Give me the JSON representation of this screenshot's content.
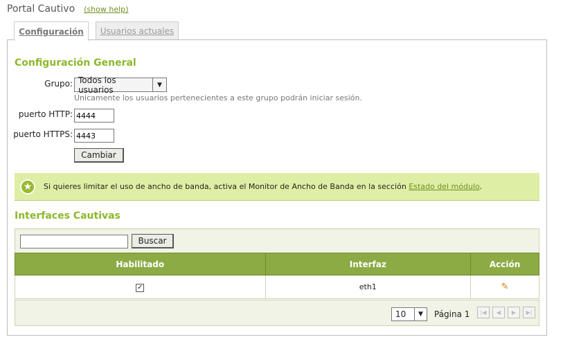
{
  "header": {
    "title": "Portal Cautivo",
    "help_link": "(show help)"
  },
  "tabs": [
    {
      "label": "Configuración",
      "active": true
    },
    {
      "label": "Usuarios actuales",
      "active": false
    }
  ],
  "general": {
    "title": "Configuración General",
    "group_label": "Grupo:",
    "group_value": "Todos los usuarios",
    "group_hint": "Únicamente los usuarios pertenecientes a este grupo podrán iniciar sesión.",
    "http_label": "puerto HTTP:",
    "http_value": "4444",
    "https_label": "puerto HTTPS:",
    "https_value": "4443",
    "submit_label": "Cambiar"
  },
  "note": {
    "text": "Si quieres limitar el uso de ancho de banda, activa el Monitor de Ancho de Banda en la sección ",
    "link": "Estado del módulo",
    "end": "."
  },
  "interfaces": {
    "title": "Interfaces Cautivas",
    "search_value": "",
    "search_button": "Buscar",
    "columns": [
      "Habilitado",
      "Interfaz",
      "Acción"
    ],
    "rows": [
      {
        "enabled": true,
        "enabled_mark": "✓",
        "interface": "eth1",
        "action_icon": "pencil-icon"
      }
    ],
    "page_size": "10",
    "page_label": "Página 1"
  },
  "colors": {
    "accent_green": "#8cb82b",
    "header_green": "#8cab45",
    "note_bg": "#dfeea5",
    "edit_orange": "#d07a10"
  }
}
